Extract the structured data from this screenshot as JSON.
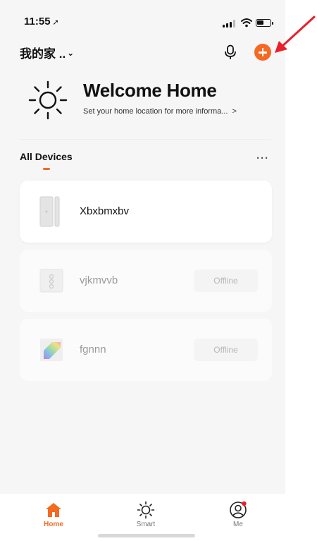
{
  "status_bar": {
    "time": "11:55",
    "location_glyph": "➚"
  },
  "header": {
    "home_name": "我的家 ..",
    "chevron": "⌄",
    "mic_icon": "microphone-icon",
    "add_icon": "plus-icon"
  },
  "welcome": {
    "title": "Welcome Home",
    "subtitle": "Set your home location for more informa...",
    "arrow": ">"
  },
  "devices_section": {
    "title": "All Devices",
    "more": "···"
  },
  "devices": [
    {
      "name": "Xbxbmxbv",
      "status": "online"
    },
    {
      "name": "vjkmvvb",
      "status": "offline",
      "status_label": "Offline"
    },
    {
      "name": "fgnnn",
      "status": "offline",
      "status_label": "Offline"
    }
  ],
  "tabs": [
    {
      "label": "Home",
      "icon": "home-icon",
      "active": true
    },
    {
      "label": "Smart",
      "icon": "sun-icon",
      "active": false
    },
    {
      "label": "Me",
      "icon": "user-icon",
      "active": false
    }
  ],
  "colors": {
    "accent": "#f46a22",
    "annotation_arrow": "#e8202a"
  }
}
